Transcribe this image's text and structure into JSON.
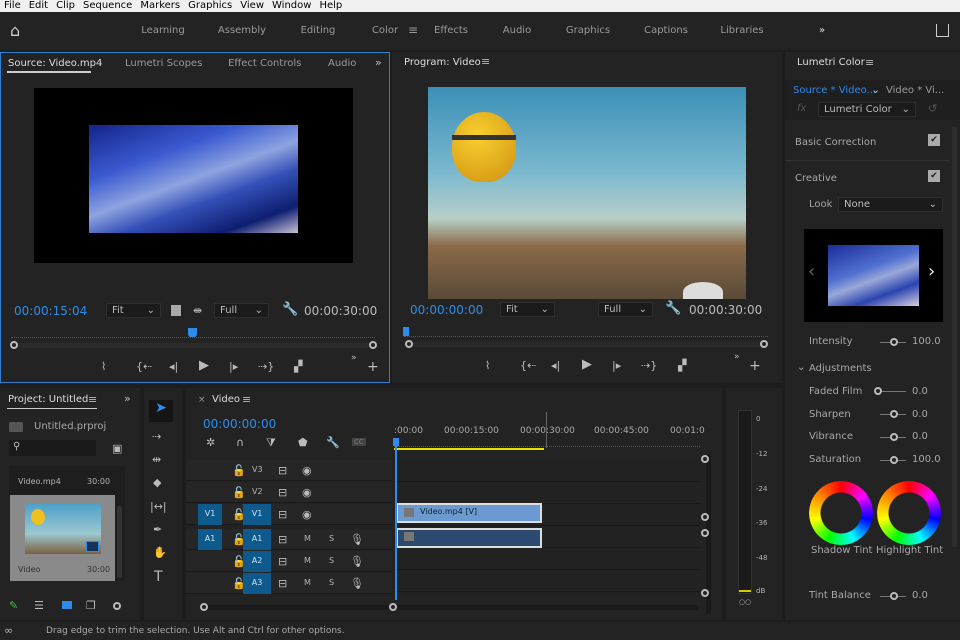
{
  "menu": [
    "File",
    "Edit",
    "Clip",
    "Sequence",
    "Markers",
    "Graphics",
    "View",
    "Window",
    "Help"
  ],
  "workspaces": [
    "Learning",
    "Assembly",
    "Editing",
    "Color",
    "Effects",
    "Audio",
    "Graphics",
    "Captions",
    "Libraries"
  ],
  "active_workspace": "Color",
  "source": {
    "tabs": [
      "Source: Video.mp4",
      "Lumetri Scopes",
      "Effect Controls",
      "Audio"
    ],
    "timecode": "00:00:15:04",
    "fit": "Fit",
    "quality": "Full",
    "duration": "00:00:30:00",
    "playhead_fraction": 0.5
  },
  "program": {
    "title": "Program: Video",
    "timecode": "00:00:00:00",
    "fit": "Fit",
    "quality": "Full",
    "duration": "00:00:30:00",
    "playhead_fraction": 0.0
  },
  "project": {
    "title": "Project: Untitled",
    "file": "Untitled.prproj",
    "items": [
      {
        "name": "Video.mp4",
        "duration": "30:00"
      },
      {
        "name": "Video",
        "duration": "30:00"
      }
    ]
  },
  "timeline": {
    "title": "Video",
    "timecode": "00:00:00:00",
    "ruler": [
      ":00:00",
      "00:00:15:00",
      "00:00:30:00",
      "00:00:45:00",
      "00:01:0"
    ],
    "video_tracks": [
      "V3",
      "V2",
      "V1"
    ],
    "audio_tracks": [
      "A1",
      "A2",
      "A3"
    ],
    "src_v": "V1",
    "src_a": "A1",
    "m": "M",
    "s": "S",
    "clip_label": "Video.mp4 [V]",
    "cc": "CC"
  },
  "meter": {
    "ticks": [
      "0",
      "-12",
      "-24",
      "-36",
      "-48",
      "dB"
    ]
  },
  "lumetri": {
    "title": "Lumetri Color",
    "src_tab": "Source * Video...",
    "seq_tab": "Video * Vi...",
    "effect": "Lumetri Color",
    "fx": "fx",
    "basic": "Basic Correction",
    "creative": "Creative",
    "look_label": "Look",
    "look_value": "None",
    "intensity_label": "Intensity",
    "intensity": "100.0",
    "adjustments": "Adjustments",
    "rows": [
      {
        "label": "Faded Film",
        "value": "0.0"
      },
      {
        "label": "Sharpen",
        "value": "0.0"
      },
      {
        "label": "Vibrance",
        "value": "0.0"
      },
      {
        "label": "Saturation",
        "value": "100.0"
      }
    ],
    "shadow_tint": "Shadow Tint",
    "highlight_tint": "Highlight Tint",
    "tint_balance": "Tint Balance",
    "tint_balance_value": "0.0"
  },
  "status": "Drag edge to trim the selection. Use Alt and Ctrl for other options."
}
